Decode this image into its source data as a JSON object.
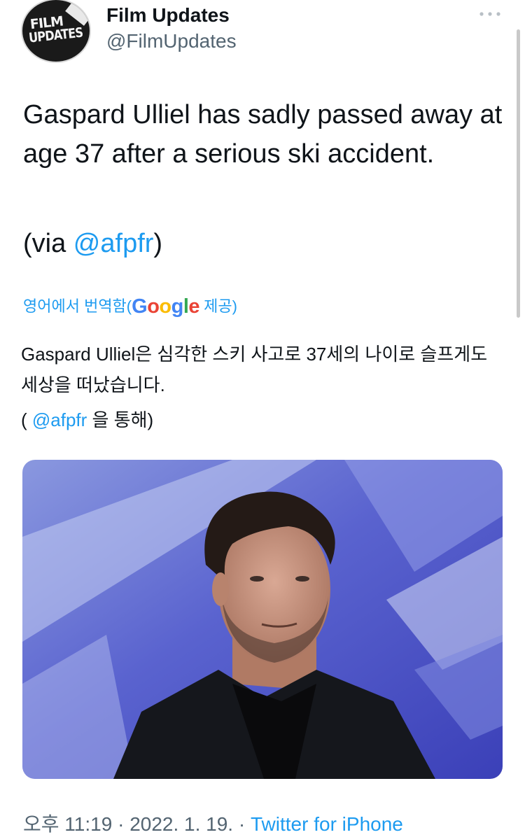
{
  "author": {
    "display_name": "Film Updates",
    "handle": "@FilmUpdates",
    "avatar_text": "FILM UPDATES",
    "avatar_line1": "FILM",
    "avatar_line2": "UPDATES"
  },
  "more_icon": "more-horizontal-icon",
  "tweet": {
    "text": "Gaspard Ulliel has sadly passed away at age 37 after a serious ski accident.",
    "via_prefix": "(via ",
    "via_mention": "@afpfr",
    "via_suffix": ")"
  },
  "translation": {
    "label_prefix": "영어에서 번역함(",
    "provider": "Google",
    "label_suffix": " 제공)",
    "text": "Gaspard Ulliel은 심각한 스키 사고로 37세의 나이로 슬프게도 세상을 떠났습니다.",
    "via_prefix": "( ",
    "via_mention": "@afpfr",
    "via_suffix": " 을 통해)"
  },
  "media": {
    "image_icon": "portrait-photo"
  },
  "meta": {
    "time": "오후 11:19",
    "separator": " · ",
    "date": "2022. 1. 19.",
    "source": "Twitter for iPhone"
  },
  "colors": {
    "link": "#1d9bf0",
    "secondary_text": "#536471",
    "primary_text": "#0f1419"
  }
}
